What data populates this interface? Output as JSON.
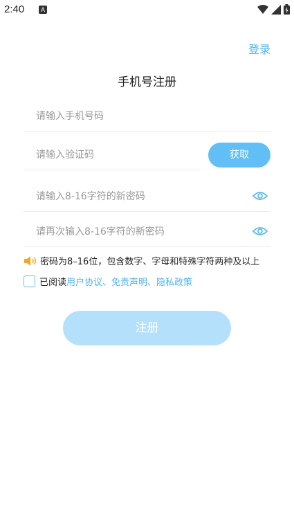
{
  "status_bar": {
    "time": "2:40",
    "notification_letter": "A"
  },
  "header": {
    "login_label": "登录",
    "title": "手机号注册"
  },
  "form": {
    "phone_placeholder": "请输入手机号码",
    "code_placeholder": "请输入验证码",
    "get_code_label": "获取",
    "password_placeholder": "请输入8-16字符的新密码",
    "password_confirm_placeholder": "请再次输入8-16字符的新密码"
  },
  "hint": {
    "text": "密码为8–16位，包含数字、字母和特殊字符两种及以上"
  },
  "agreement": {
    "prefix": "已阅读",
    "links": "用户协议、免责声明、隐私政策"
  },
  "register_label": "注册",
  "colors": {
    "accent": "#4fb4f0",
    "button": "#62bff5",
    "register_disabled": "#b5e0fb",
    "speaker": "#f5a623"
  }
}
